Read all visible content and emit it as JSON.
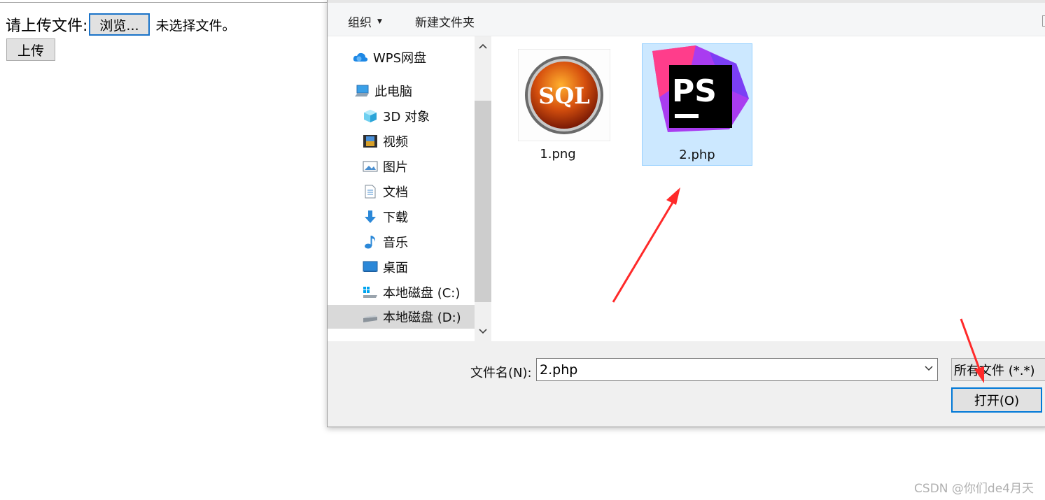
{
  "upload_form": {
    "label": "请上传文件:",
    "browse_label": "浏览...",
    "no_file_text": "未选择文件。",
    "upload_label": "上传"
  },
  "dialog": {
    "toolbar": {
      "organize": "组织",
      "new_folder": "新建文件夹"
    },
    "nav": {
      "items": [
        {
          "label": "WPS网盘",
          "icon": "cloud-icon"
        },
        {
          "label": "此电脑",
          "icon": "computer-icon"
        },
        {
          "label": "3D 对象",
          "icon": "cube-icon"
        },
        {
          "label": "视频",
          "icon": "video-icon"
        },
        {
          "label": "图片",
          "icon": "picture-icon"
        },
        {
          "label": "文档",
          "icon": "document-icon"
        },
        {
          "label": "下载",
          "icon": "download-icon"
        },
        {
          "label": "音乐",
          "icon": "music-icon"
        },
        {
          "label": "桌面",
          "icon": "desktop-icon"
        },
        {
          "label": "本地磁盘 (C:)",
          "icon": "drive-icon"
        },
        {
          "label": "本地磁盘 (D:)",
          "icon": "drive-icon",
          "selected": true
        }
      ]
    },
    "files": [
      {
        "name": "1.png",
        "thumb_text": "SQL",
        "icon": "sql-image-icon"
      },
      {
        "name": "2.php",
        "thumb_text": "PS",
        "icon": "phpstorm-icon",
        "selected": true
      }
    ],
    "filename_label": "文件名(N):",
    "filename_value": "2.php",
    "filetype_value": "所有文件 (*.*)",
    "open_label": "打开(O)"
  },
  "watermark": "CSDN @你们de4月天",
  "colors": {
    "selection_bg": "#cce8ff",
    "selection_border": "#99d1ff",
    "accent": "#0078d7",
    "annotation": "#ff2a2a"
  }
}
